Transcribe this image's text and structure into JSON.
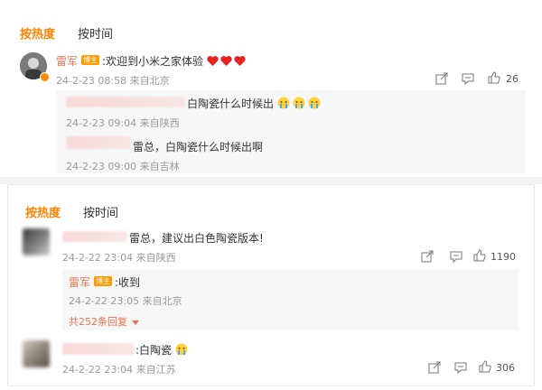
{
  "panel1": {
    "tabs": [
      "按热度",
      "按时间"
    ],
    "comment": {
      "author": "雷军",
      "badge": "博主",
      "text": ":欢迎到小米之家体验",
      "meta": "24-2-23 08:58 来自北京",
      "like_count": "26"
    },
    "replies": [
      {
        "text": "白陶瓷什么时候出",
        "meta": "24-2-23 09:04 来自陕西"
      },
      {
        "text": "雷总，白陶瓷什么时候出啊",
        "meta": "24-2-23 09:00 来自吉林"
      }
    ]
  },
  "panel2": {
    "tabs": [
      "按热度",
      "按时间"
    ],
    "comments": [
      {
        "text": "雷总，建议出白色陶瓷版本!",
        "meta": "24-2-22 23:04 来自陕西",
        "like_count": "1190"
      },
      {
        "text": ":白陶瓷",
        "meta": "24-2-22 23:04 来自江苏",
        "like_count": "306"
      }
    ],
    "reply": {
      "author": "雷军",
      "badge": "博主",
      "text": ":收到",
      "meta": "24-2-22 23:05 来自北京"
    },
    "more_replies": "共252条回复"
  },
  "colors": {
    "accent": "#ff8200",
    "name": "#eb7350",
    "meta": "#999999"
  },
  "icons": [
    "share-icon",
    "comment-icon",
    "like-icon",
    "heart-icon",
    "crying-emoji-icon",
    "chevron-down-icon"
  ]
}
